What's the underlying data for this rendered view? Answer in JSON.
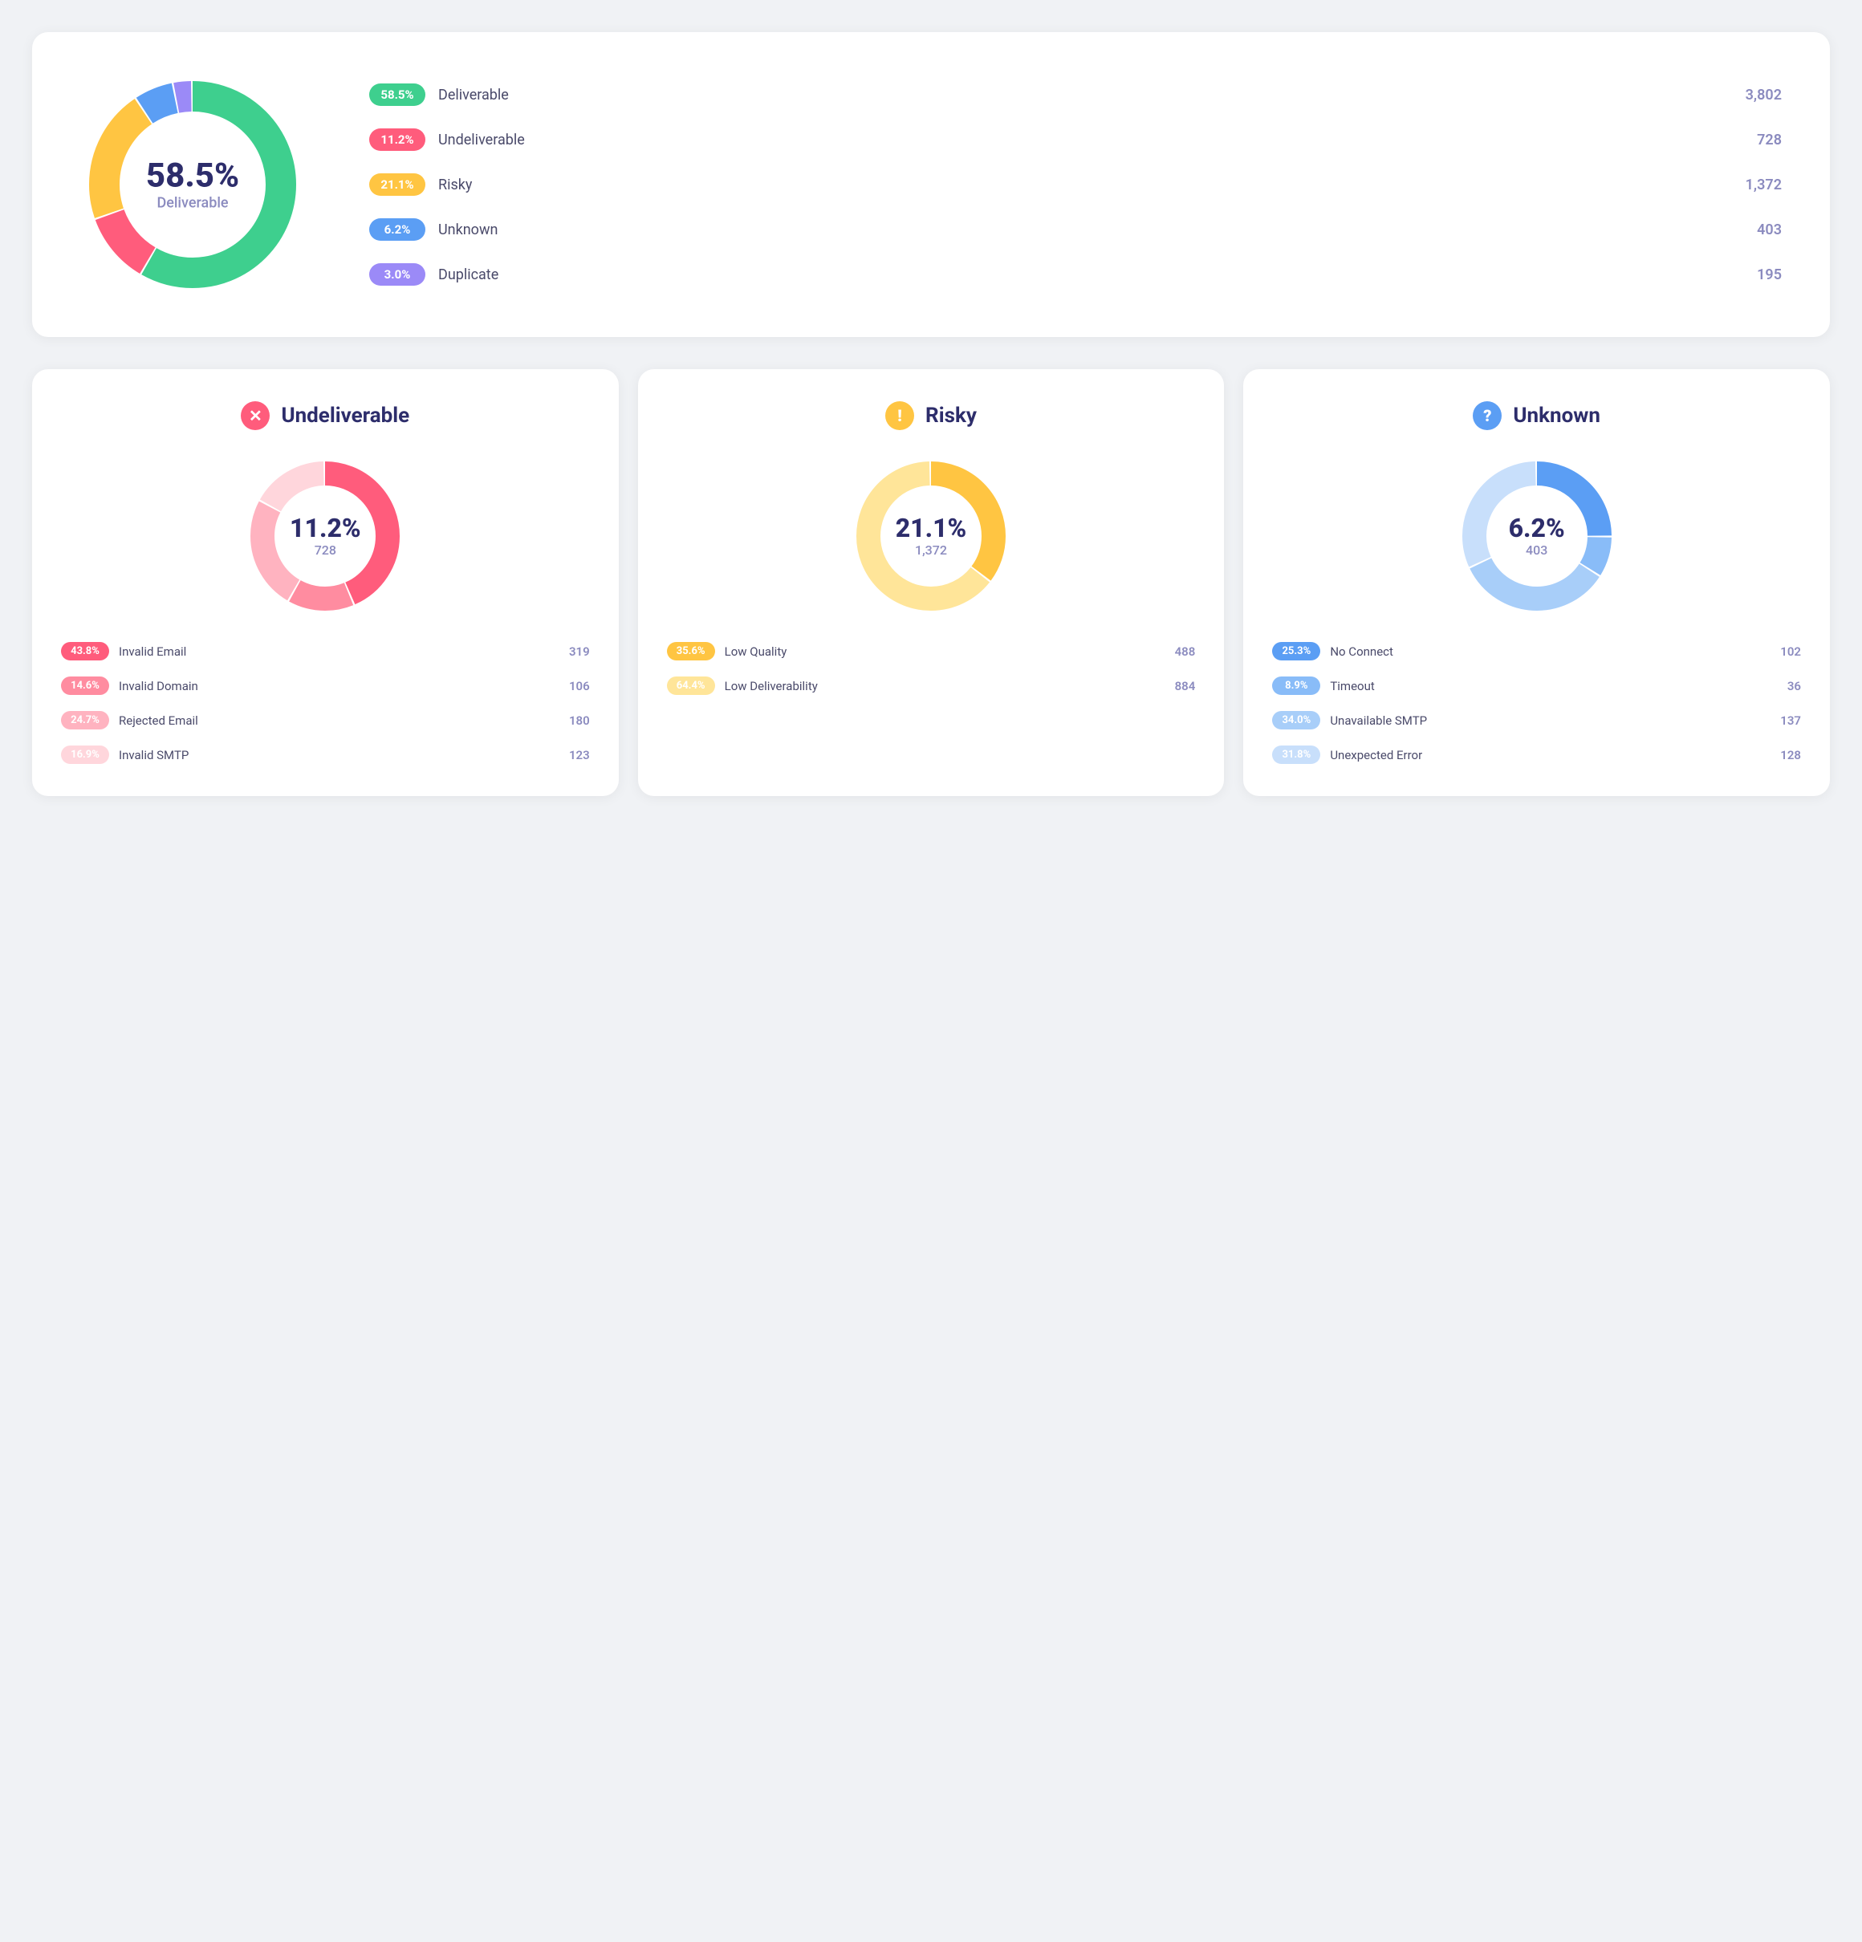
{
  "topChart": {
    "centerPct": "58.5%",
    "centerLabel": "Deliverable",
    "legend": [
      {
        "label": "58.5%",
        "name": "Deliverable",
        "count": "3,802",
        "color": "#3ecf8e"
      },
      {
        "label": "11.2%",
        "name": "Undeliverable",
        "count": "728",
        "color": "#ff5c7c"
      },
      {
        "label": "21.1%",
        "name": "Risky",
        "count": "1,372",
        "color": "#ffc542"
      },
      {
        "label": "6.2%",
        "name": "Unknown",
        "count": "403",
        "color": "#5b9ef4"
      },
      {
        "label": "3.0%",
        "name": "Duplicate",
        "count": "195",
        "color": "#9b8af7"
      }
    ],
    "segments": [
      {
        "pct": 58.5,
        "color": "#3ecf8e"
      },
      {
        "pct": 11.2,
        "color": "#ff5c7c"
      },
      {
        "pct": 21.1,
        "color": "#ffc542"
      },
      {
        "pct": 6.2,
        "color": "#5b9ef4"
      },
      {
        "pct": 3.0,
        "color": "#9b8af7"
      }
    ]
  },
  "cards": [
    {
      "id": "undeliverable",
      "iconChar": "✕",
      "iconClass": "icon-red",
      "title": "Undeliverable",
      "pct": "11.2%",
      "count": "728",
      "segments": [
        {
          "pct": 43.8,
          "color": "#ff5c7c"
        },
        {
          "pct": 14.6,
          "color": "#ff8ca0"
        },
        {
          "pct": 24.7,
          "color": "#ffb3c0"
        },
        {
          "pct": 16.9,
          "color": "#ffd6dc"
        }
      ],
      "items": [
        {
          "label": "43.8%",
          "name": "Invalid Email",
          "count": "319",
          "color": "#ff5c7c"
        },
        {
          "label": "14.6%",
          "name": "Invalid Domain",
          "count": "106",
          "color": "#ff8ca0"
        },
        {
          "label": "24.7%",
          "name": "Rejected Email",
          "count": "180",
          "color": "#ffb3c0"
        },
        {
          "label": "16.9%",
          "name": "Invalid SMTP",
          "count": "123",
          "color": "#ffd6dc"
        }
      ]
    },
    {
      "id": "risky",
      "iconChar": "!",
      "iconClass": "icon-yellow",
      "title": "Risky",
      "pct": "21.1%",
      "count": "1,372",
      "segments": [
        {
          "pct": 35.6,
          "color": "#ffc542"
        },
        {
          "pct": 64.4,
          "color": "#ffe599"
        }
      ],
      "items": [
        {
          "label": "35.6%",
          "name": "Low Quality",
          "count": "488",
          "color": "#ffc542"
        },
        {
          "label": "64.4%",
          "name": "Low Deliverability",
          "count": "884",
          "color": "#ffe599"
        }
      ]
    },
    {
      "id": "unknown",
      "iconChar": "?",
      "iconClass": "icon-blue",
      "title": "Unknown",
      "pct": "6.2%",
      "count": "403",
      "segments": [
        {
          "pct": 25.3,
          "color": "#5b9ef4"
        },
        {
          "pct": 8.9,
          "color": "#89bcf8"
        },
        {
          "pct": 34.0,
          "color": "#a8cef9"
        },
        {
          "pct": 31.8,
          "color": "#c8dffb"
        }
      ],
      "items": [
        {
          "label": "25.3%",
          "name": "No Connect",
          "count": "102",
          "color": "#5b9ef4"
        },
        {
          "label": "8.9%",
          "name": "Timeout",
          "count": "36",
          "color": "#89bcf8"
        },
        {
          "label": "34.0%",
          "name": "Unavailable SMTP",
          "count": "137",
          "color": "#a8cef9"
        },
        {
          "label": "31.8%",
          "name": "Unexpected Error",
          "count": "128",
          "color": "#c8dffb"
        }
      ]
    }
  ]
}
